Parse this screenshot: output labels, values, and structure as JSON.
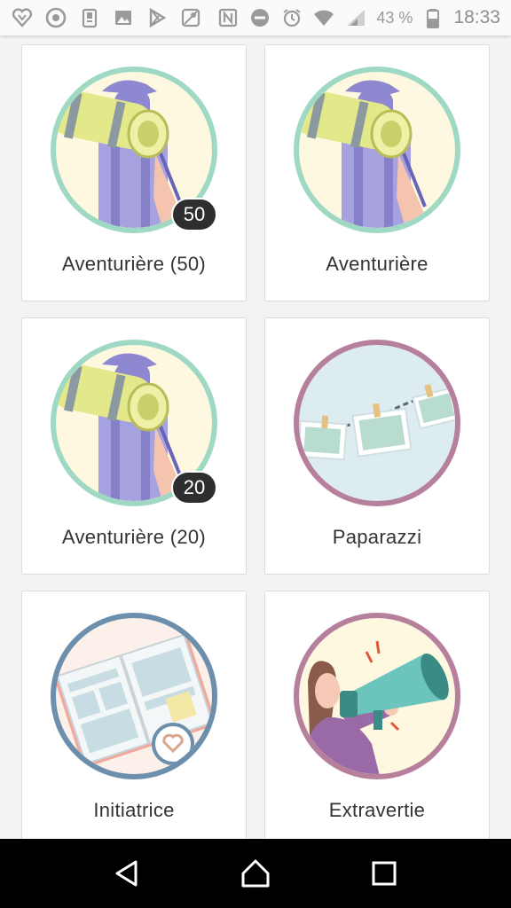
{
  "status_bar": {
    "left_icons": [
      "heart-icon",
      "chrome-icon",
      "clipboard-icon",
      "image-icon",
      "play-store-icon",
      "maps-icon"
    ],
    "right_icons": [
      "nfc-icon",
      "dnd-icon",
      "alarm-icon",
      "wifi-icon",
      "signal-icon",
      "battery-icon"
    ],
    "battery": "43 %",
    "time": "18:33"
  },
  "badges": [
    {
      "label": "Aventurière (50)",
      "count": "50",
      "theme": "hiker"
    },
    {
      "label": "Aventurière",
      "count": "",
      "theme": "hiker"
    },
    {
      "label": "Aventurière (20)",
      "count": "20",
      "theme": "hiker"
    },
    {
      "label": "Paparazzi",
      "count": "",
      "theme": "photos"
    },
    {
      "label": "Initiatrice",
      "count": "",
      "theme": "planner"
    },
    {
      "label": "Extravertie",
      "count": "",
      "theme": "megaphone"
    }
  ],
  "colors": {
    "hiker_ring": "#9fd9c3",
    "photos_ring": "#b67f9c",
    "planner_ring": "#6b8fac",
    "megaphone_ring": "#b67f9c"
  },
  "nav_bar": {
    "buttons": [
      "back-icon",
      "home-icon",
      "recents-icon"
    ]
  }
}
